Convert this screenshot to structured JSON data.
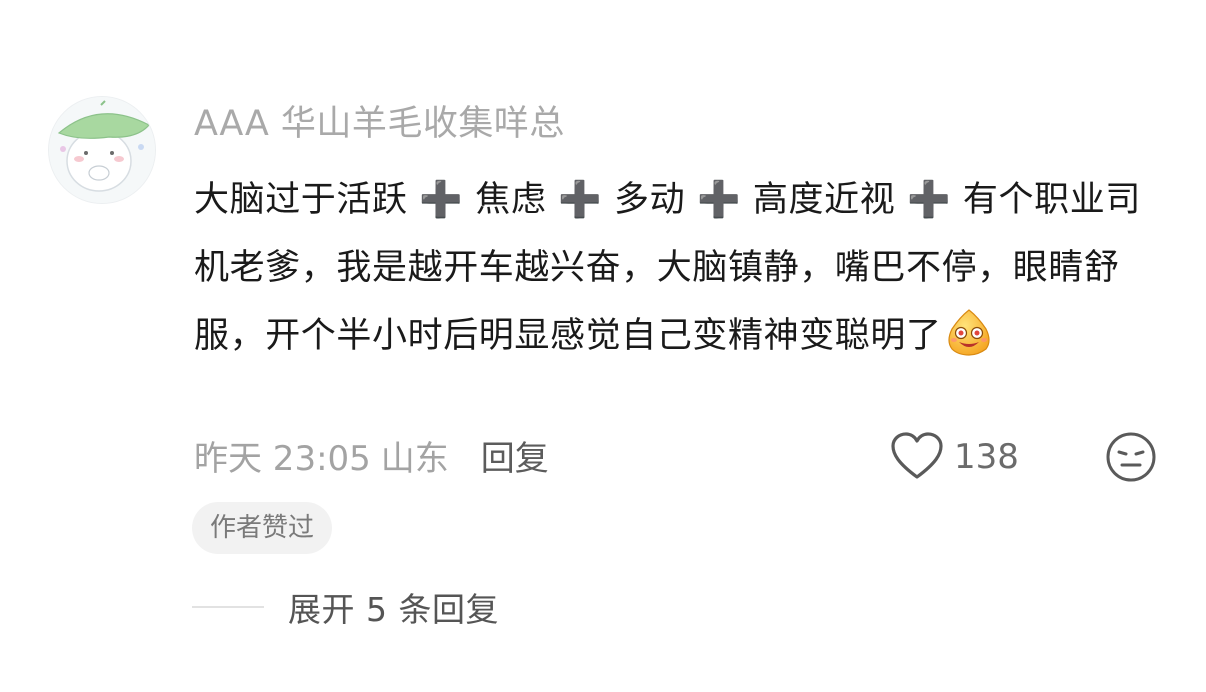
{
  "comment": {
    "username": "AAA 华山羊毛收集咩总",
    "body": "大脑过于活跃 ➕ 焦虑 ➕ 多动 ➕ 高度近视 ➕ 有个职业司机老爹，我是越开车越兴奋，大脑镇静，嘴巴不停，眼睛舒服，开个半小时后明显感觉自己变精神变聪明了",
    "emoji_icon": "smug-face-emoji-icon",
    "time": "昨天 23:05",
    "location": "山东",
    "reply_label": "回复",
    "like_count": "138",
    "author_liked_badge": "作者赞过",
    "expand_replies_label": "展开 5 条回复"
  },
  "colors": {
    "username": "#a9a9a9",
    "body_text": "#1a1a1a",
    "meta": "#a3a3a3",
    "badge_bg": "#f2f2f2"
  },
  "icons": {
    "avatar": "avatar-leaf-girl",
    "like": "heart-outline-icon",
    "dislike": "meh-face-icon"
  }
}
